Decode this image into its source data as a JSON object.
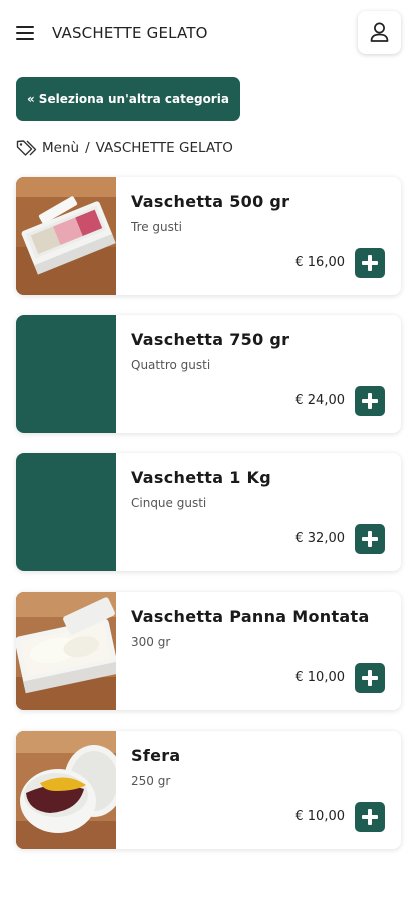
{
  "header": {
    "title": "VASCHETTE GELATO",
    "menu_icon": "hamburger-menu-icon",
    "user_icon": "user-icon"
  },
  "back_button": {
    "label": "Seleziona un'altra categoria",
    "icon": "double-chevron-left-icon"
  },
  "breadcrumb": {
    "icon": "tags-icon",
    "home": "Menù",
    "separator": "/",
    "current": "VASCHETTE GELATO"
  },
  "products": [
    {
      "name": "Vaschetta 500 gr",
      "description": "Tre gusti",
      "price": "€ 16,00",
      "image": "tray-photo"
    },
    {
      "name": "Vaschetta 750 gr",
      "description": "Quattro gusti",
      "price": "€ 24,00",
      "image": "placeholder"
    },
    {
      "name": "Vaschetta 1 Kg",
      "description": "Cinque gusti",
      "price": "€ 32,00",
      "image": "placeholder"
    },
    {
      "name": "Vaschetta Panna Montata",
      "description": "300 gr",
      "price": "€ 10,00",
      "image": "cream-photo"
    },
    {
      "name": "Sfera",
      "description": "250 gr",
      "price": "€ 10,00",
      "image": "sphere-photo"
    }
  ],
  "colors": {
    "accent": "#1f5c52",
    "background": "#ffffff"
  }
}
